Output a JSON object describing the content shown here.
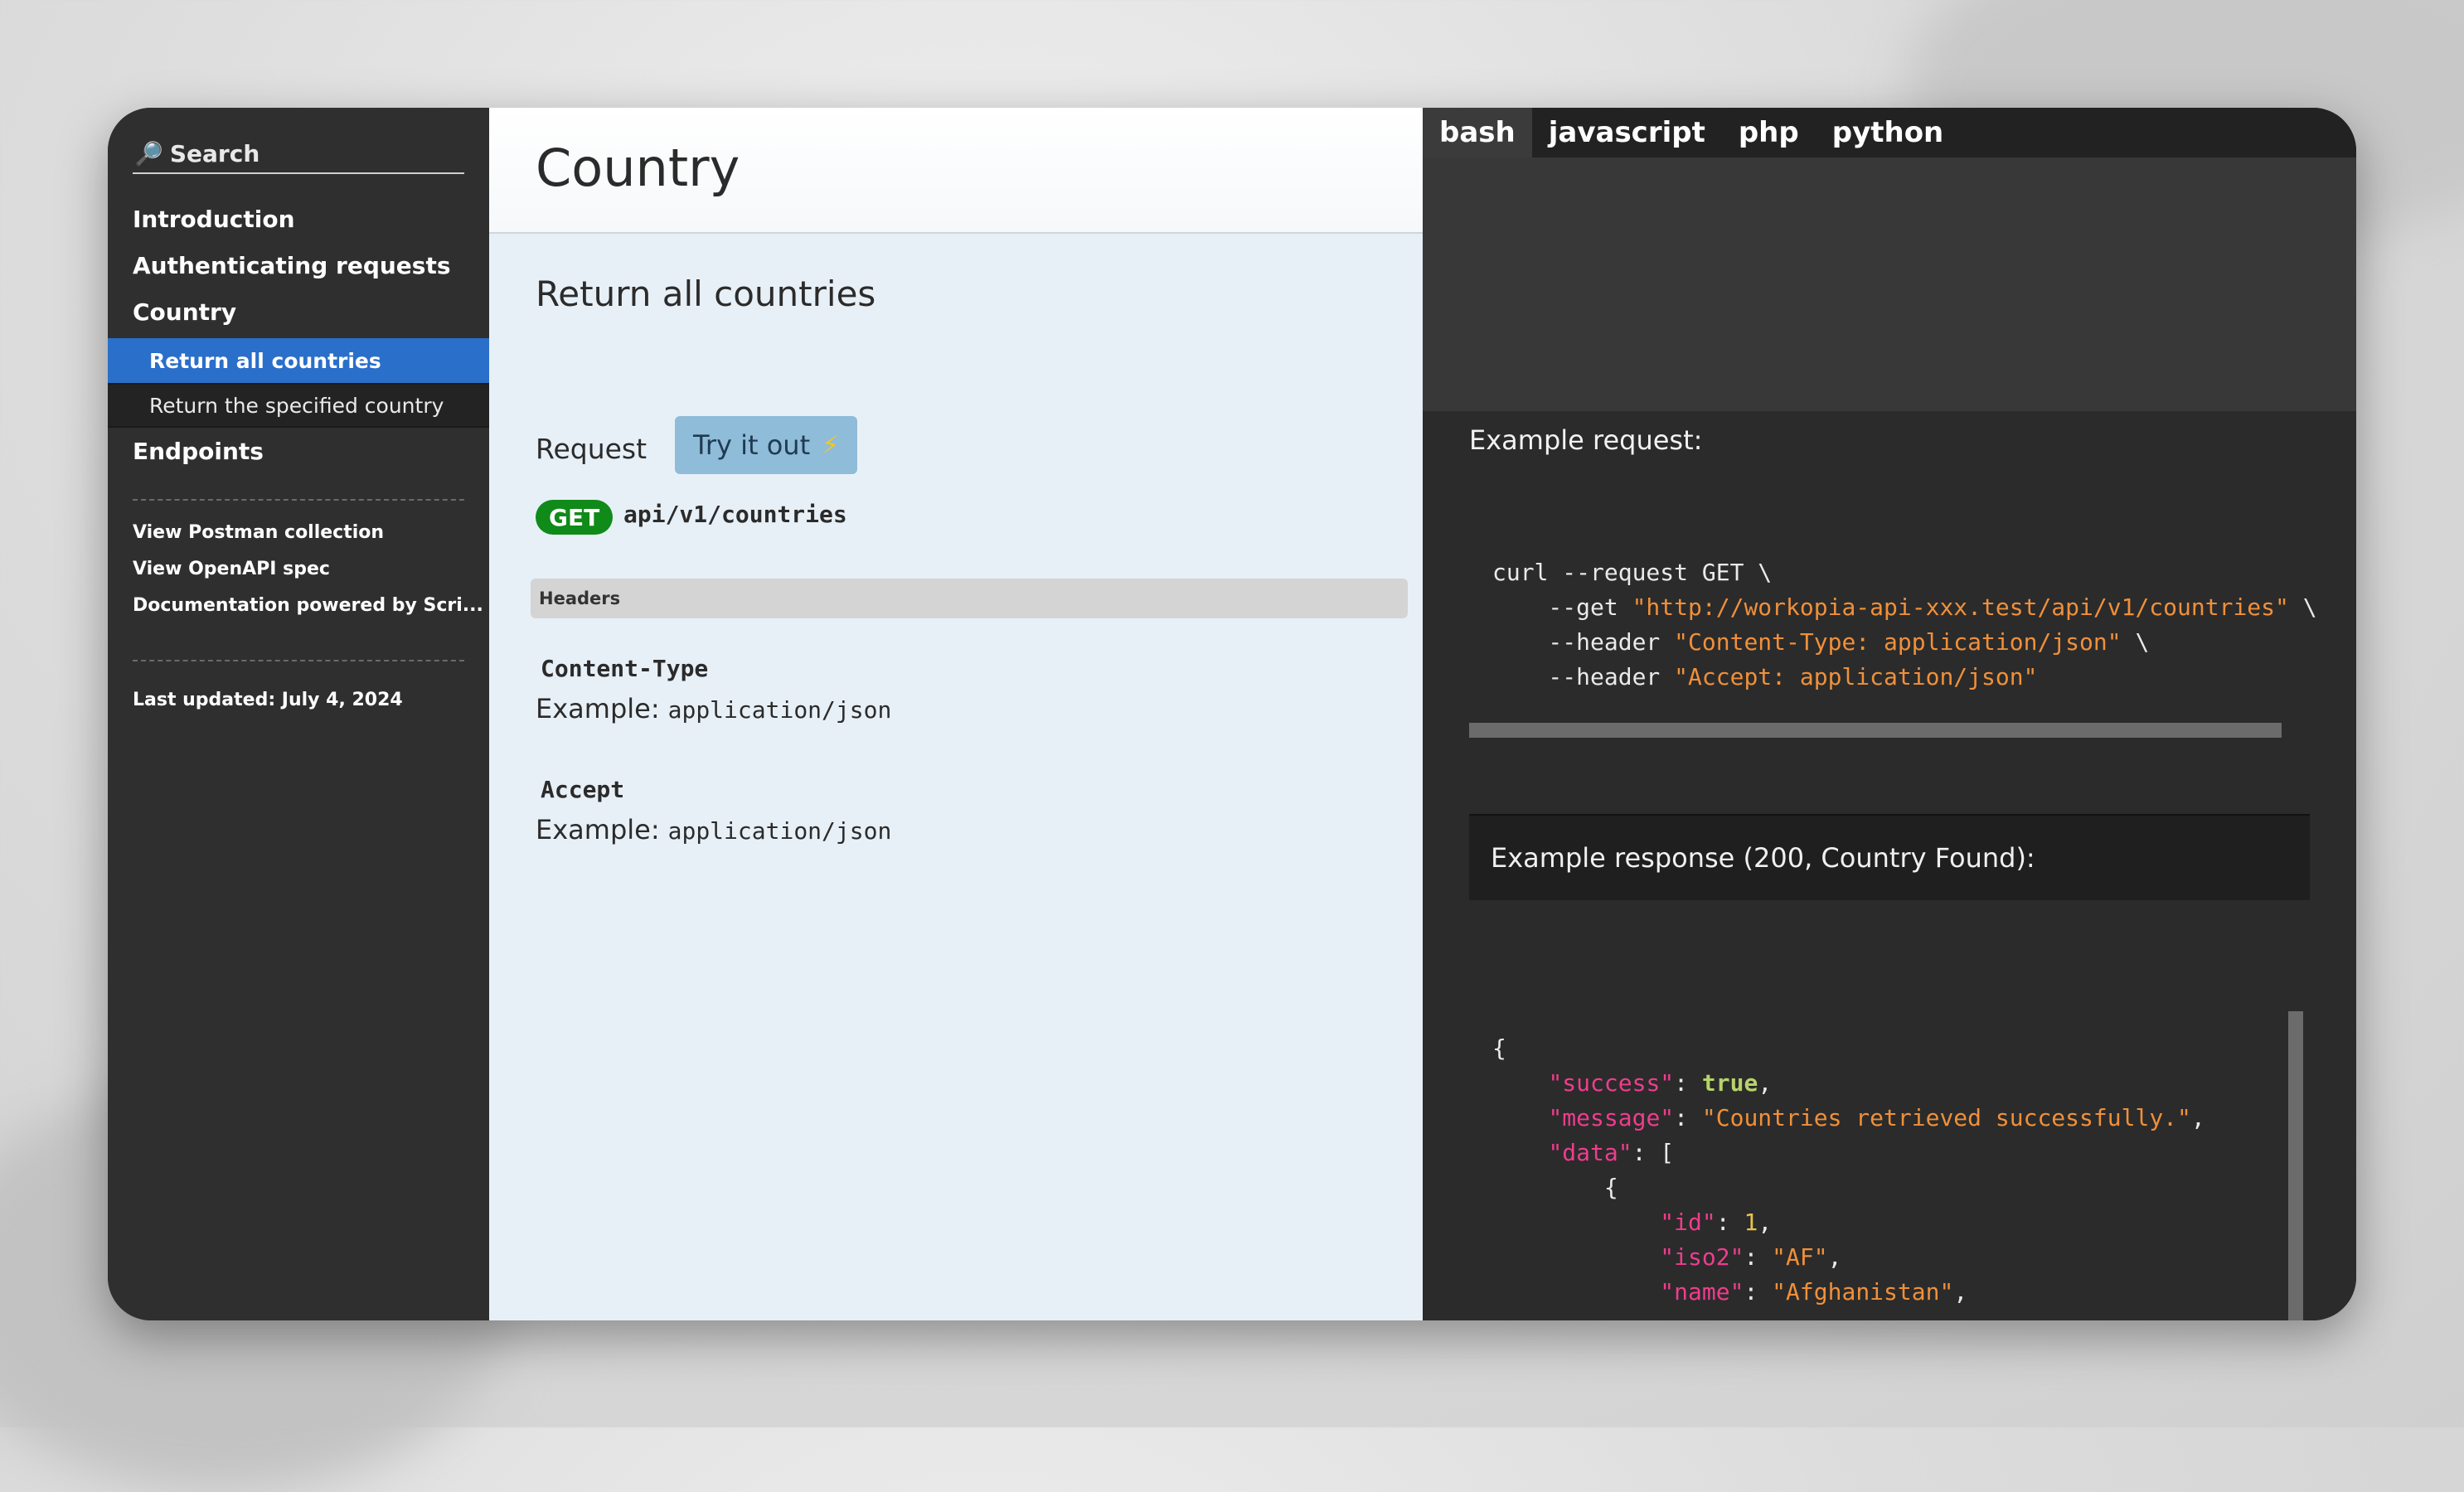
{
  "sidebar": {
    "search_placeholder": "Search",
    "nav": {
      "introduction": "Introduction",
      "authenticating": "Authenticating requests",
      "country": "Country",
      "country_items": [
        "Return all countries",
        "Return the specified country"
      ],
      "endpoints": "Endpoints"
    },
    "links": [
      "View Postman collection",
      "View OpenAPI spec",
      "Documentation powered by Scri..."
    ],
    "last_updated": "Last updated: July 4, 2024"
  },
  "main": {
    "page_title": "Country",
    "section_title": "Return all countries",
    "request_label": "Request",
    "try_button": "Try it out",
    "method": "GET",
    "endpoint": "api/v1/countries",
    "headers_label": "Headers",
    "headers": [
      {
        "name": "Content-Type",
        "example_label": "Example:",
        "example_value": "application/json"
      },
      {
        "name": "Accept",
        "example_label": "Example:",
        "example_value": "application/json"
      }
    ]
  },
  "code_panel": {
    "tabs": [
      "bash",
      "javascript",
      "php",
      "python"
    ],
    "active_tab": "bash",
    "example_request_label": "Example request:",
    "request": {
      "line1": "curl --request GET \\",
      "get_flag": "    --get ",
      "url": "\"http://workopia-api-xxx.test/api/v1/countries\"",
      "url_cont": " \\",
      "header_flag": "    --header ",
      "header1": "\"Content-Type: application/json\"",
      "header1_cont": " \\",
      "header2": "\"Accept: application/json\""
    },
    "example_response_label": "Example response (200, Country Found):",
    "response": {
      "open_brace": "{",
      "success_key": "\"success\"",
      "success_val": "true",
      "message_key": "\"message\"",
      "message_val": "\"Countries retrieved successfully.\"",
      "data_key": "\"data\"",
      "id_key": "\"id\"",
      "id_val": "1",
      "iso2_key": "\"iso2\"",
      "iso2_val": "\"AF\"",
      "name_key": "\"name\"",
      "name_val": "\"Afghanistan\""
    }
  }
}
